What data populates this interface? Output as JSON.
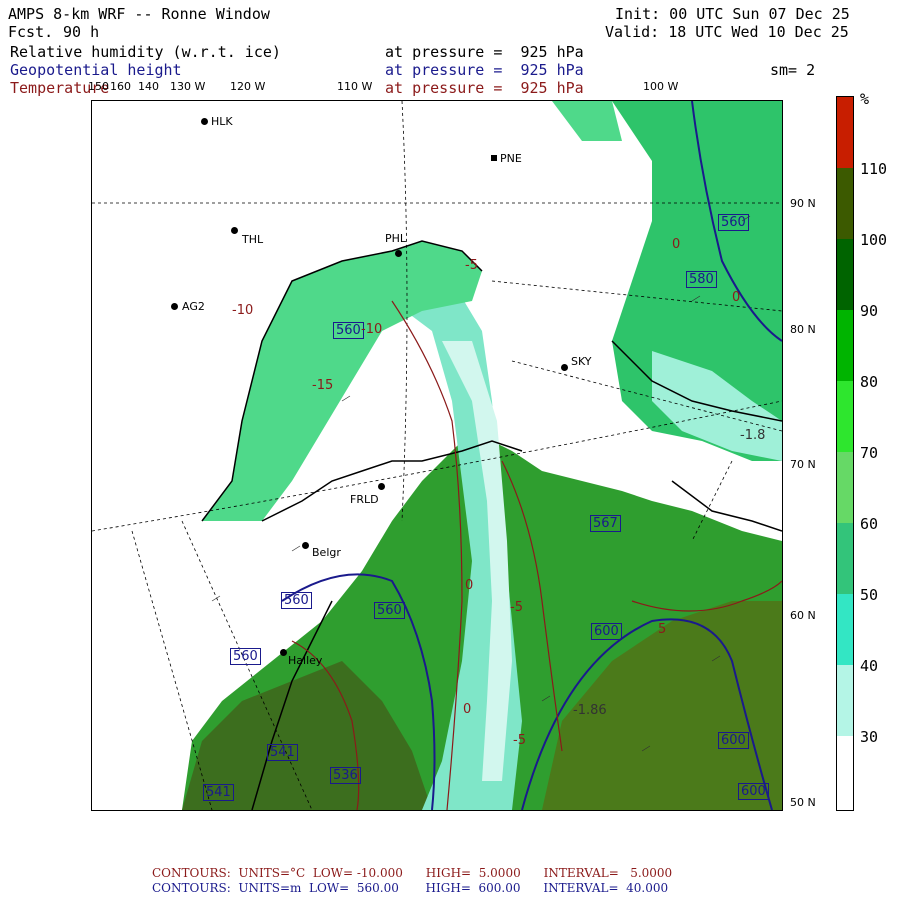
{
  "header": {
    "model": "AMPS 8-km WRF -- Ronne Window",
    "forecast_label": "Fcst.",
    "forecast_hours": "90 h",
    "init": "Init: 00 UTC Sun 07 Dec 25",
    "valid": "Valid: 18 UTC Wed 10 Dec 25",
    "fields": [
      {
        "name": "Relative humidity (w.r.t. ice)",
        "level": "at pressure =  925 hPa",
        "color": "#000000"
      },
      {
        "name": "Geopotential height",
        "level": "at pressure =  925 hPa",
        "color": "#1a1a8c"
      },
      {
        "name": "Temperature",
        "level": "at pressure =  925 hPa",
        "color": "#8b1a1a"
      }
    ],
    "smoothing": "sm= 2"
  },
  "longitude_labels": [
    "150",
    "160",
    "140",
    "130 W",
    "120 W",
    "110 W",
    "100 W"
  ],
  "latitude_labels": [
    "90 N",
    "80 N",
    "70 N",
    "60 N",
    "50 N"
  ],
  "stations": [
    "HLK",
    "PNE",
    "THL",
    "PHL",
    "AG2",
    "SKY",
    "Belgr",
    "Halley",
    "FRLD"
  ],
  "colorbar": {
    "unit": "%",
    "labels": [
      "110",
      "100",
      "90",
      "80",
      "70",
      "60",
      "50",
      "40",
      "30"
    ],
    "colors": [
      "#c81e00",
      "#3c5a00",
      "#006400",
      "#00b400",
      "#2ee62e",
      "#66d966",
      "#33c47a",
      "#33e6c4",
      "#b4f5e6",
      "#ffffff"
    ]
  },
  "contour_labels_height": [
    "560",
    "560",
    "580",
    "560",
    "567",
    "600",
    "600",
    "560",
    "560",
    "541",
    "536",
    "600",
    "541"
  ],
  "contour_labels_temp": [
    "-5",
    "-10",
    "-10",
    "-15",
    "0",
    "-5",
    "0",
    "-5",
    "0",
    "-1.86",
    "-1.8",
    "5",
    "0"
  ],
  "footer": {
    "line1": "CONTOURS:  UNITS=°C  LOW= -10.000      HIGH=  5.0000      INTERVAL=   5.0000",
    "line2": "CONTOURS:  UNITS=m  LOW=  560.00       HIGH=  600.00      INTERVAL=  40.000"
  }
}
